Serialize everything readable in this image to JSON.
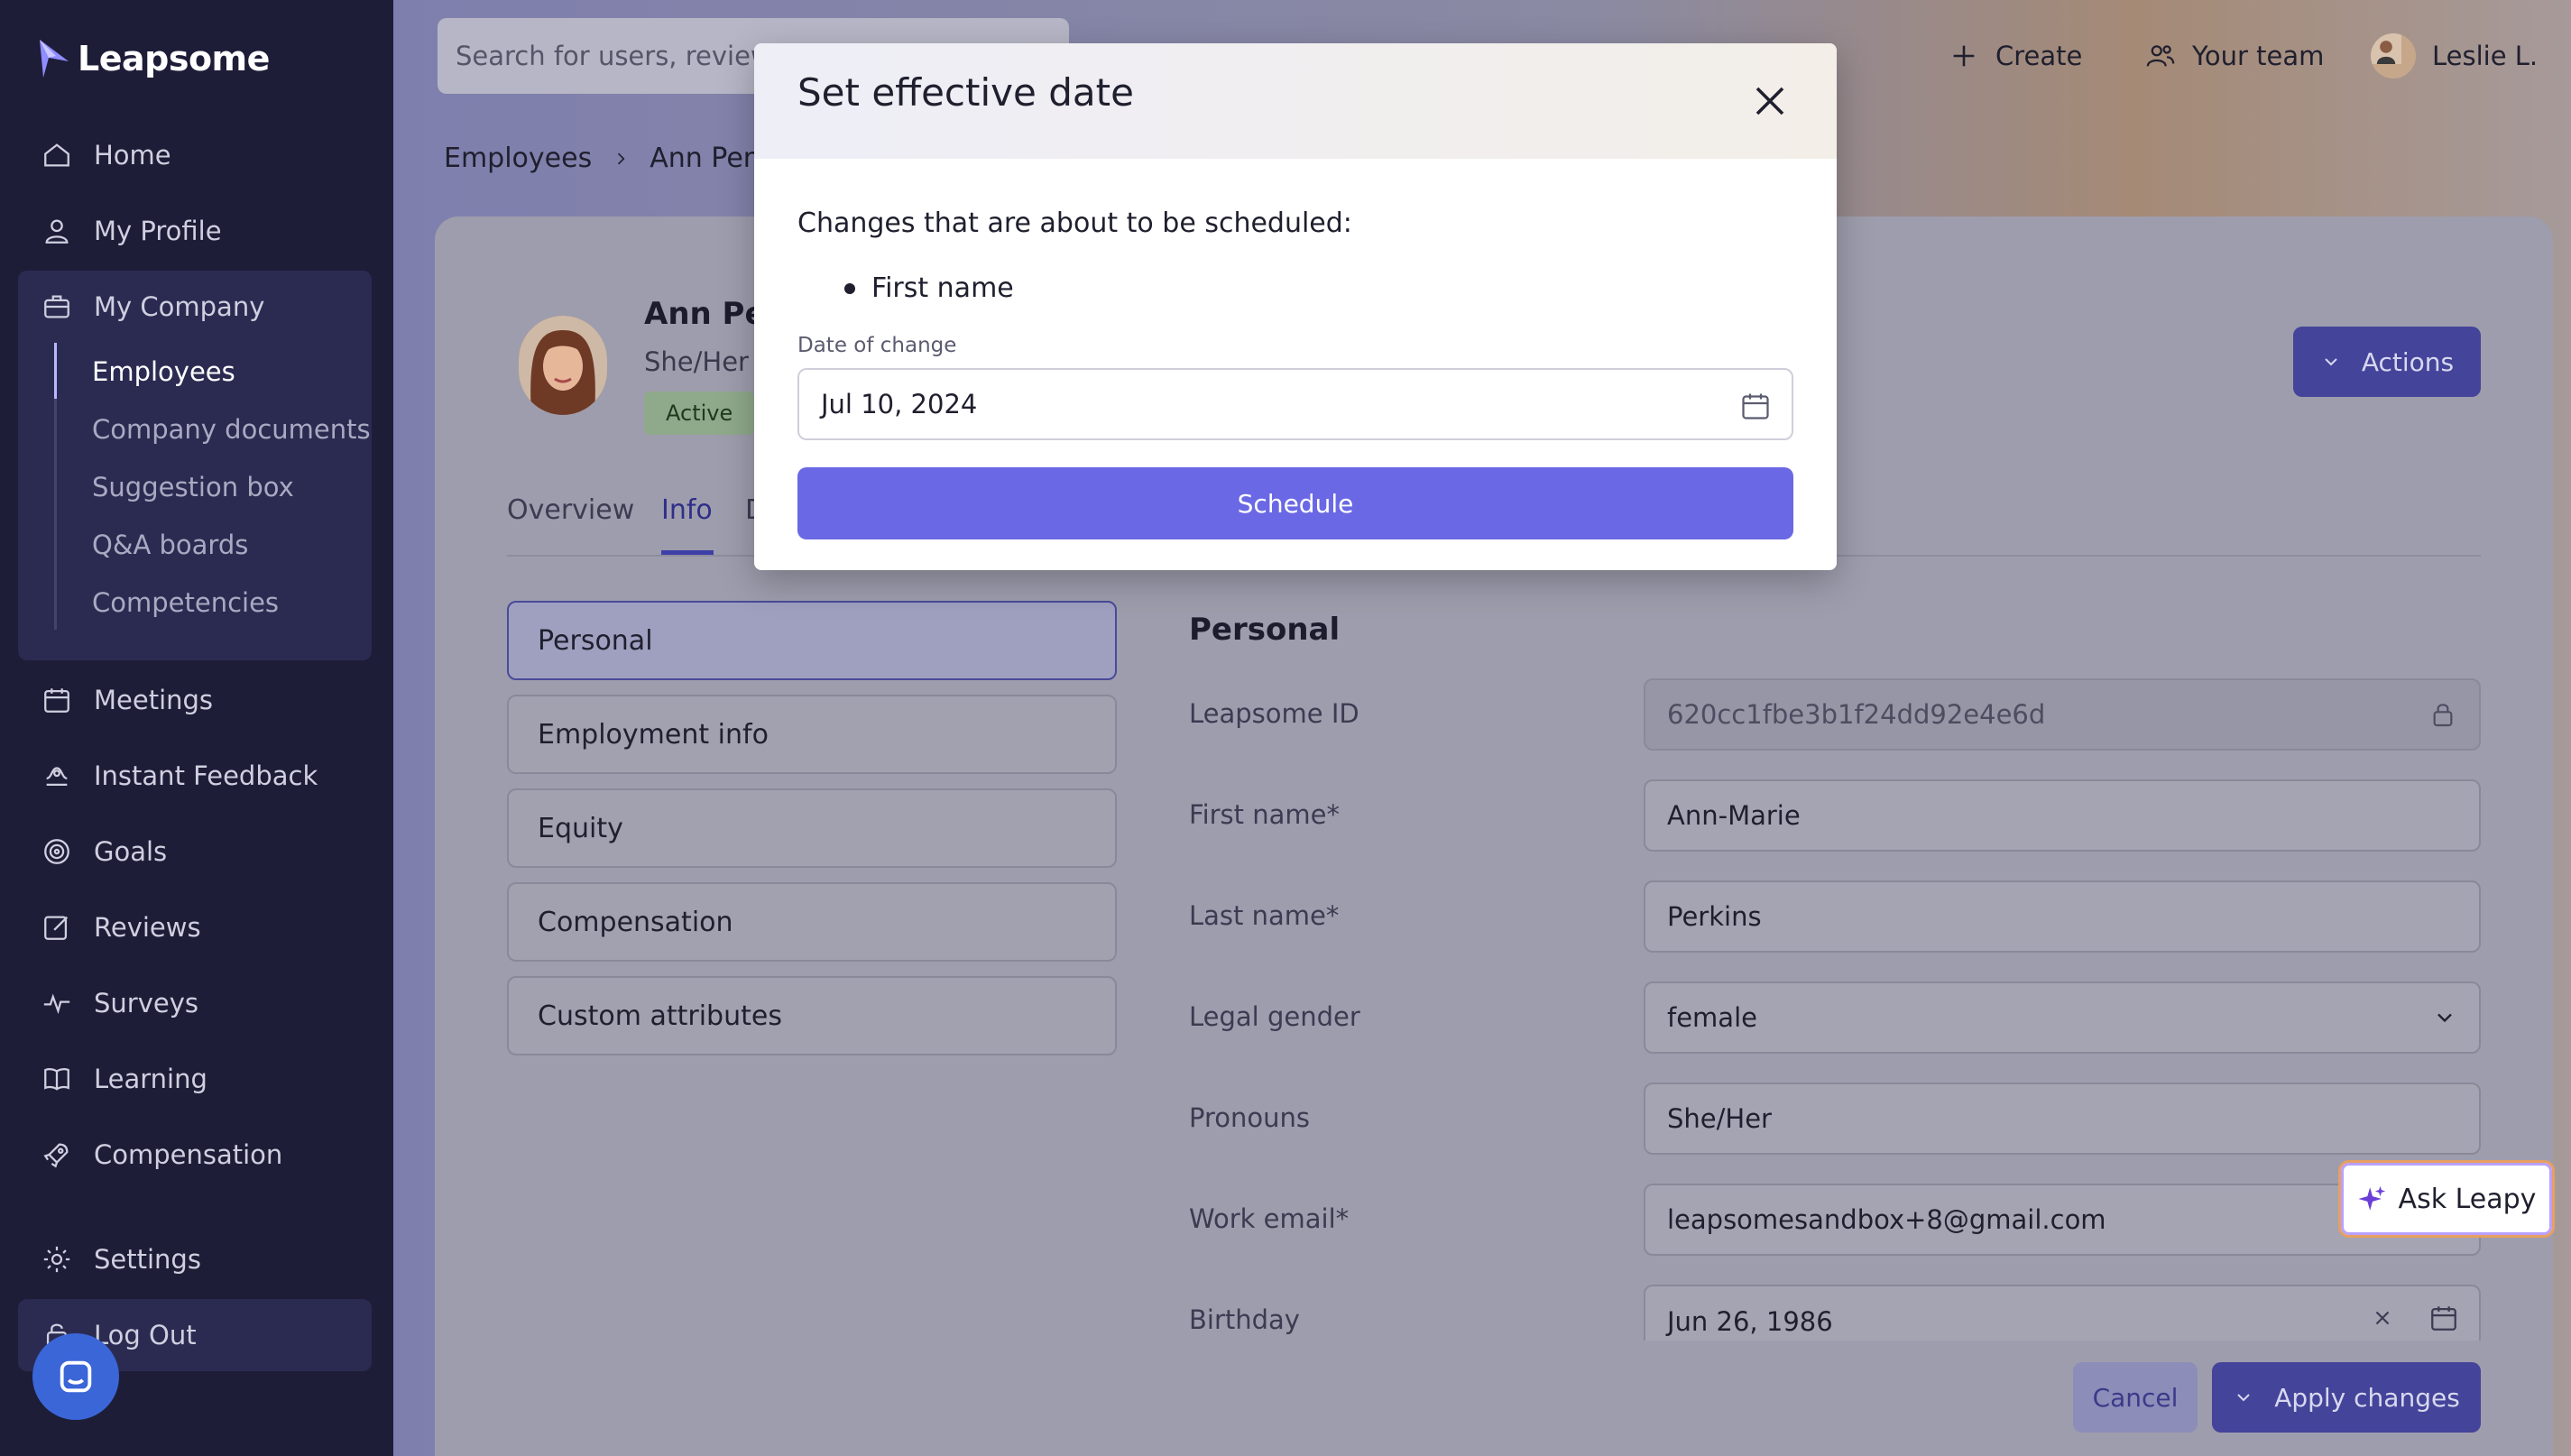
{
  "sidebar": {
    "brand": "Leapsome",
    "nav": [
      {
        "label": "Home",
        "icon": "home-icon"
      },
      {
        "label": "My Profile",
        "icon": "user-icon"
      },
      {
        "label": "My Company",
        "icon": "briefcase-icon"
      },
      {
        "label": "Meetings",
        "icon": "calendar-icon"
      },
      {
        "label": "Instant Feedback",
        "icon": "feedback-icon"
      },
      {
        "label": "Goals",
        "icon": "target-icon"
      },
      {
        "label": "Reviews",
        "icon": "edit-icon"
      },
      {
        "label": "Surveys",
        "icon": "pulse-icon"
      },
      {
        "label": "Learning",
        "icon": "book-icon"
      },
      {
        "label": "Compensation",
        "icon": "rocket-icon"
      },
      {
        "label": "Settings",
        "icon": "gear-icon"
      },
      {
        "label": "Log Out",
        "icon": "logout-icon"
      }
    ],
    "company_sub": [
      "Employees",
      "Company documents",
      "Suggestion box",
      "Q&A boards",
      "Competencies"
    ]
  },
  "topbar": {
    "search_placeholder": "Search for users, reviews",
    "create": "Create",
    "your_team": "Your team",
    "user": "Leslie L."
  },
  "breadcrumb": [
    "Employees",
    "Ann Perkin"
  ],
  "profile": {
    "name": "Ann Pe",
    "pronouns": "She/Her",
    "status": "Active",
    "actions": "Actions"
  },
  "tabs": [
    "Overview",
    "Info",
    "D"
  ],
  "sections": [
    "Personal",
    "Employment info",
    "Equity",
    "Compensation",
    "Custom attributes"
  ],
  "personal": {
    "title": "Personal",
    "fields": [
      {
        "label": "Leapsome ID",
        "value": "620cc1fbe3b1f24dd92e4e6d"
      },
      {
        "label": "First name*",
        "value": "Ann-Marie"
      },
      {
        "label": "Last name*",
        "value": "Perkins"
      },
      {
        "label": "Legal gender",
        "value": "female"
      },
      {
        "label": "Pronouns",
        "value": "She/Her"
      },
      {
        "label": "Work email*",
        "value": "leapsomesandbox+8@gmail.com"
      },
      {
        "label": "Birthday",
        "value": "Jun 26, 1986"
      }
    ]
  },
  "ask_leapy": "Ask Leapy",
  "footer": {
    "cancel": "Cancel",
    "apply": "Apply changes"
  },
  "modal": {
    "title": "Set effective date",
    "intro": "Changes that are about to be scheduled:",
    "changes": [
      "First name"
    ],
    "date_label": "Date of change",
    "date_value": "Jul 10, 2024",
    "schedule": "Schedule"
  },
  "colors": {
    "sidebar": "#1d1d38",
    "accent": "#6a68e4",
    "primary_dark": "#44449a"
  }
}
